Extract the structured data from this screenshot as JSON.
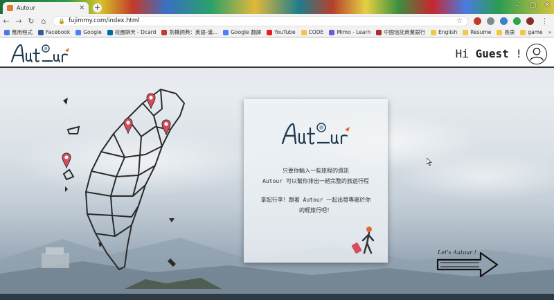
{
  "browser": {
    "tab_title": "Autour",
    "tab_close": "✕",
    "new_tab": "+",
    "url": "fujimmy.com/index.html",
    "bookmarks": [
      {
        "label": "應用程式",
        "color": "#4a7be0"
      },
      {
        "label": "Facebook",
        "color": "#3b5998"
      },
      {
        "label": "Google",
        "color": "#4285f4"
      },
      {
        "label": "校園聊天 - Dcard",
        "color": "#006aa6"
      },
      {
        "label": "劍橋詞典：英語-漢...",
        "color": "#c03b2b"
      },
      {
        "label": "Google 翻譯",
        "color": "#4285f4"
      },
      {
        "label": "YouTube",
        "color": "#e62117"
      },
      {
        "label": "CODE",
        "color": "#f2c744"
      },
      {
        "label": "Mimo - Learn",
        "color": "#6b5bd6"
      },
      {
        "label": "中國信託商業銀行",
        "color": "#b02a2a"
      },
      {
        "label": "English",
        "color": "#f2c744"
      },
      {
        "label": "Resume",
        "color": "#f2c744"
      },
      {
        "label": "長庚",
        "color": "#f2c744"
      },
      {
        "label": "game",
        "color": "#f2c744"
      }
    ],
    "bookmarks_more": "»"
  },
  "header": {
    "greeting_prefix": "Hi ",
    "user_name": "Guest",
    "greeting_suffix": " !"
  },
  "card": {
    "line1": "只要你輸入一些旅程的資訊",
    "line2": "Autour 可以幫你排出一趟完整的旅遊行程",
    "line3": "拿起行李！跟著 Autour 一起出發專屬於你",
    "line4": "的輕旅行吧！"
  },
  "cta": {
    "label": "Let's Autour !"
  },
  "colors": {
    "pin": "#d94b5a",
    "accent": "#e2682d",
    "map_stroke": "#2a2a2a"
  }
}
